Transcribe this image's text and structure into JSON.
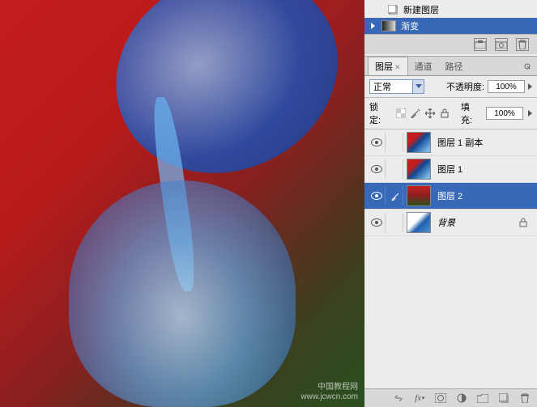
{
  "history": {
    "items": [
      {
        "label": "新建图层",
        "selected": false
      },
      {
        "label": "渐变",
        "selected": true
      }
    ]
  },
  "panel": {
    "tabs": {
      "layers": "图层",
      "channels": "通道",
      "paths": "路径"
    },
    "blend_mode": "正常",
    "opacity_label": "不透明度:",
    "opacity_value": "100%",
    "lock_label": "锁定:",
    "fill_label": "填充:",
    "fill_value": "100%"
  },
  "layers": [
    {
      "name": "图层 1 副本",
      "selected": false,
      "thumb": "water",
      "locked": false
    },
    {
      "name": "图层 1",
      "selected": false,
      "thumb": "water",
      "locked": false
    },
    {
      "name": "图层 2",
      "selected": true,
      "thumb": "gradient",
      "locked": false
    },
    {
      "name": "背景",
      "selected": false,
      "thumb": "bg",
      "locked": true,
      "italic": true
    }
  ],
  "watermark": {
    "line1": "中国教程网",
    "line2": "www.jcwcn.com"
  }
}
